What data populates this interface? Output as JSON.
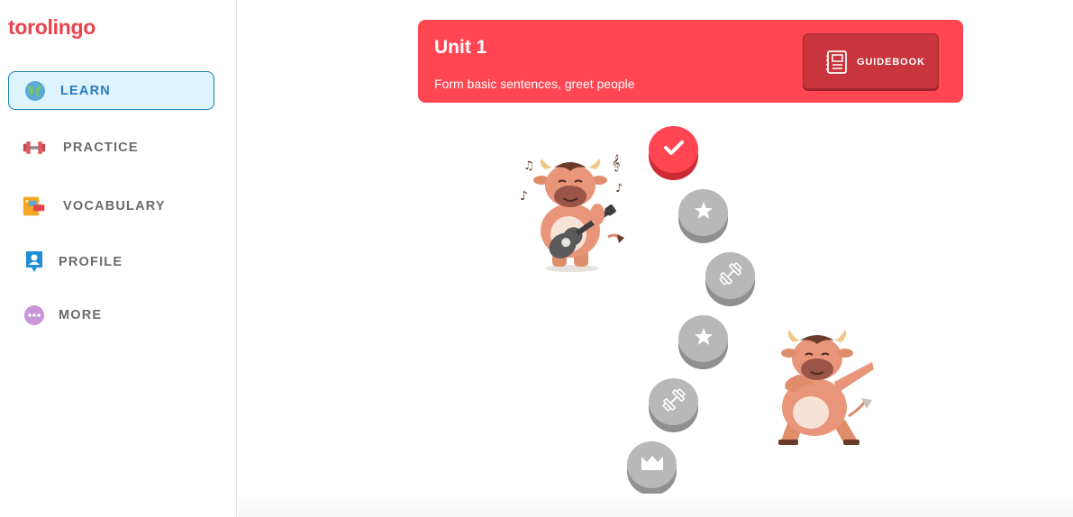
{
  "app": {
    "logo_text": "torolingo",
    "brand_color": "#e8434c"
  },
  "sidebar": {
    "items": [
      {
        "label": "LEARN",
        "icon": "globe-icon",
        "active": true
      },
      {
        "label": "PRACTICE",
        "icon": "dumbbell-icon",
        "active": false
      },
      {
        "label": "VOCABULARY",
        "icon": "flashcards-icon",
        "active": false
      },
      {
        "label": "PROFILE",
        "icon": "profile-icon",
        "active": false
      },
      {
        "label": "MORE",
        "icon": "more-dots-icon",
        "active": false
      }
    ]
  },
  "unit": {
    "title": "Unit 1",
    "subtitle": "Form basic sentences, greet people",
    "guidebook_label": "GUIDEBOOK",
    "color": "#ff4652"
  },
  "path": {
    "lessons": [
      {
        "state": "completed",
        "icon": "checkmark-icon"
      },
      {
        "state": "locked",
        "icon": "star-icon"
      },
      {
        "state": "locked",
        "icon": "dumbbell-icon"
      },
      {
        "state": "locked",
        "icon": "star-icon"
      },
      {
        "state": "locked",
        "icon": "dumbbell-icon"
      },
      {
        "state": "locked",
        "icon": "crown-icon"
      }
    ]
  },
  "mascots": [
    {
      "icon": "bull-guitar-mascot-icon"
    },
    {
      "icon": "bull-dab-mascot-icon"
    }
  ]
}
